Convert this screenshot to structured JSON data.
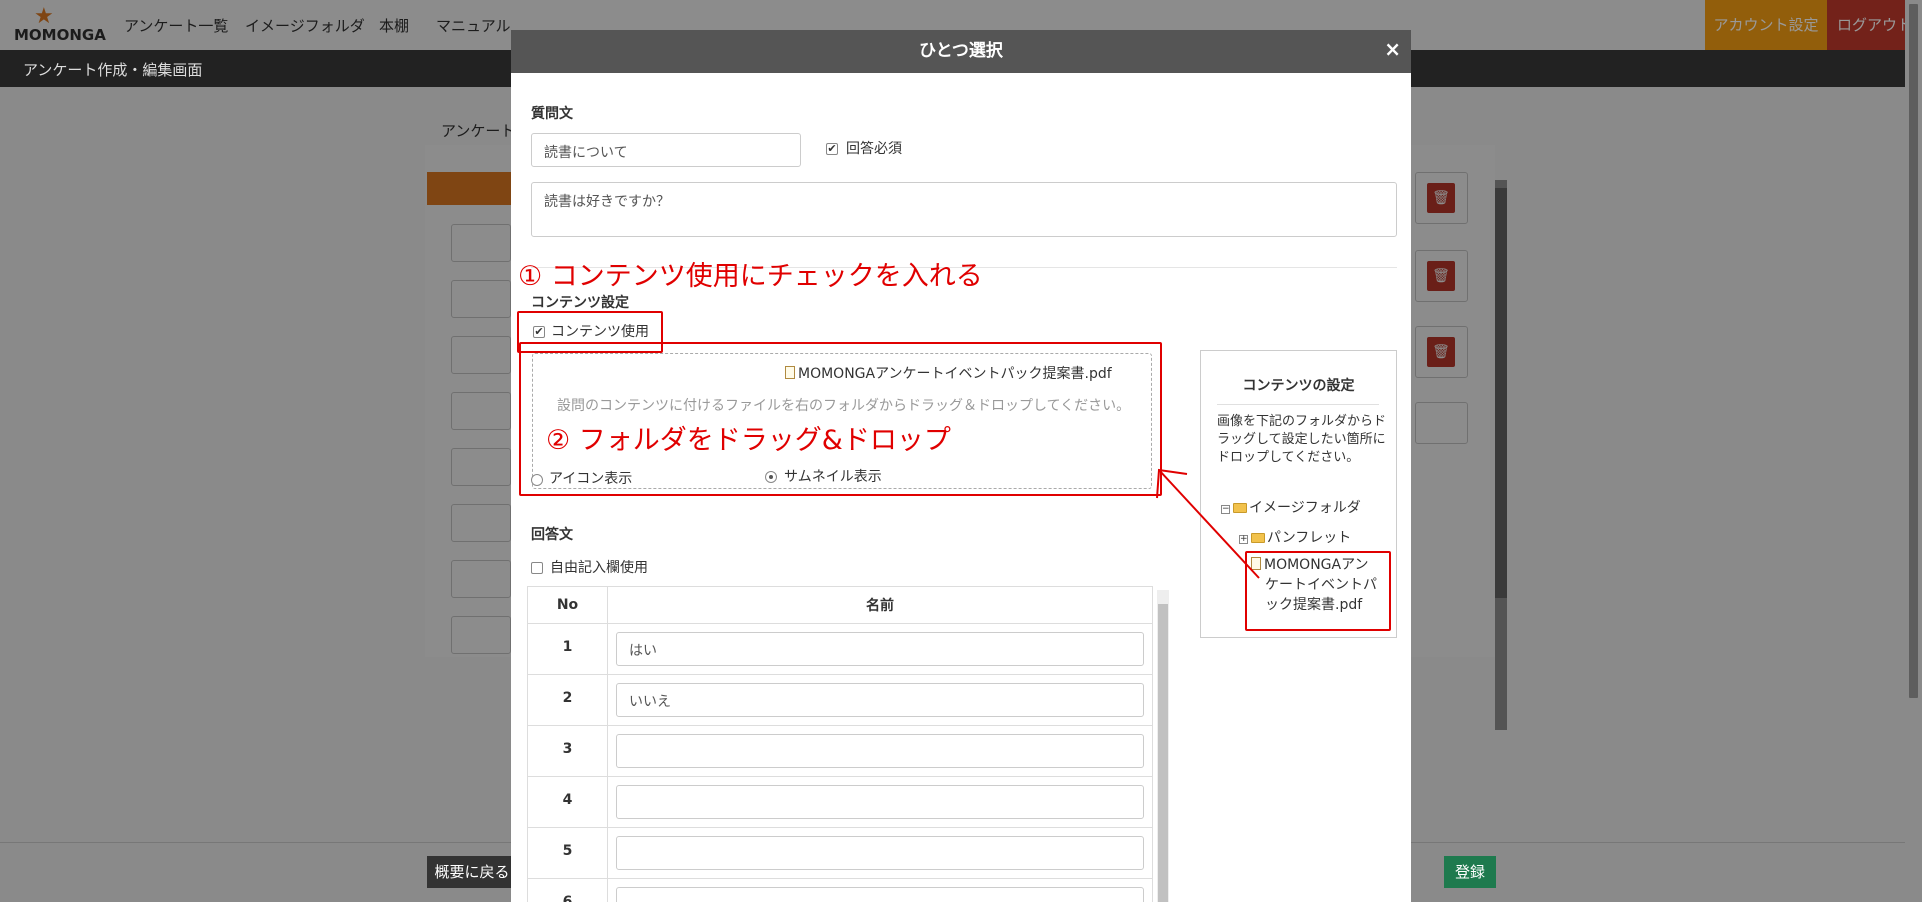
{
  "app": {
    "logo": "MOMONGA",
    "nav": [
      "アンケート一覧",
      "イメージフォルダ",
      "本棚",
      "マニュアル"
    ],
    "account_label": "アカウント設定",
    "logout_label": "ログアウト",
    "page_title": "アンケート作成・編集画面",
    "tab_label": "アンケート",
    "back_label": "概要に戻る",
    "register_label": "登録"
  },
  "modal": {
    "title": "ひとつ選択",
    "close": "×",
    "question_label": "質問文",
    "question_title_value": "読書について",
    "required_label": "回答必須",
    "required_checked": true,
    "question_body_value": "読書は好きですか？",
    "content_settings_label": "コンテンツ設定",
    "use_content_label": "コンテンツ使用",
    "use_content_checked": true,
    "dropped_file": "MOMONGAアンケートイベントパック提案書.pdf",
    "drop_hint": "設問のコンテンツに付けるファイルを右のフォルダからドラッグ＆ドロップしてください。",
    "display_icon_label": "アイコン表示",
    "display_thumb_label": "サムネイル表示",
    "display_selected": "サムネイル表示",
    "answers_label": "回答文",
    "free_entry_label": "自由記入欄使用",
    "free_entry_checked": false,
    "table": {
      "col_no": "No",
      "col_name": "名前",
      "rows": [
        {
          "no": "1",
          "name": "はい"
        },
        {
          "no": "2",
          "name": "いいえ"
        },
        {
          "no": "3",
          "name": ""
        },
        {
          "no": "4",
          "name": ""
        },
        {
          "no": "5",
          "name": ""
        },
        {
          "no": "6",
          "name": ""
        }
      ]
    }
  },
  "side_panel": {
    "title": "コンテンツの設定",
    "description": "画像を下記のフォルダからドラッグして設定したい箇所にドロップしてください。",
    "tree_root": "イメージフォルダ",
    "tree_folder": "パンフレット",
    "tree_file_lines": [
      "MOMONGAアン",
      "ケートイベントパ",
      "ック提案書.pdf"
    ]
  },
  "annotations": {
    "step1": "① コンテンツ使用にチェックを入れる",
    "step2": "② フォルダをドラッグ&ドロップ",
    "color": "#e00000"
  }
}
